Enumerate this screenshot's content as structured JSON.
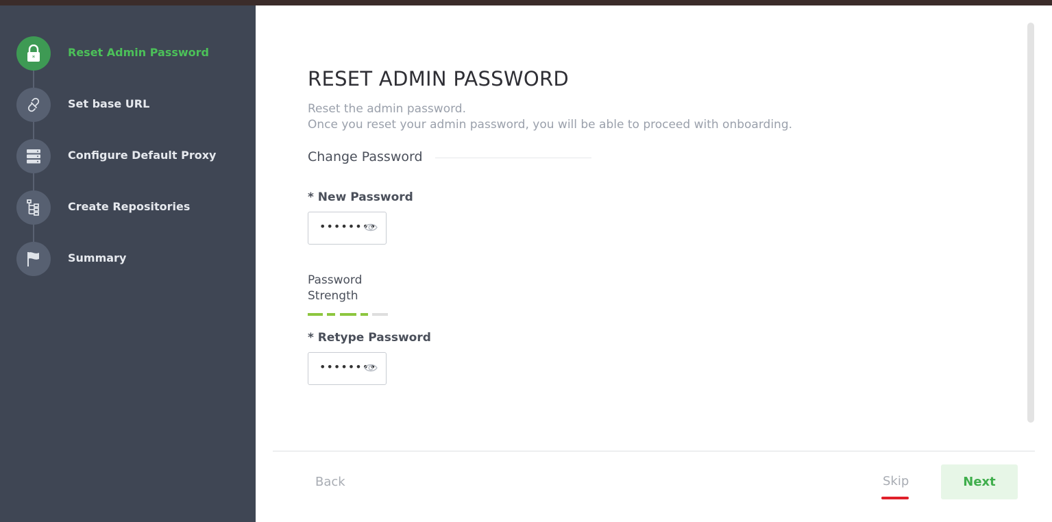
{
  "sidebar": {
    "steps": [
      {
        "label": "Reset Admin Password",
        "icon": "lock-icon",
        "active": true
      },
      {
        "label": "Set base URL",
        "icon": "link-icon",
        "active": false
      },
      {
        "label": "Configure Default Proxy",
        "icon": "server-icon",
        "active": false
      },
      {
        "label": "Create Repositories",
        "icon": "tree-icon",
        "active": false
      },
      {
        "label": "Summary",
        "icon": "flag-icon",
        "active": false
      }
    ]
  },
  "main": {
    "title": "RESET ADMIN PASSWORD",
    "description_line1": "Reset the admin password.",
    "description_line2": "Once you reset your admin password, you will be able to proceed with onboarding.",
    "section_title": "Change Password",
    "new_password": {
      "label": "* New Password",
      "masked_value": "••••••••"
    },
    "strength": {
      "label_line1": "Password",
      "label_line2": "Strength",
      "level": 4,
      "max": 5
    },
    "retype_password": {
      "label": "* Retype Password",
      "masked_value": "••••••••"
    }
  },
  "footer": {
    "back_label": "Back",
    "skip_label": "Skip",
    "next_label": "Next"
  },
  "colors": {
    "accent_green": "#4cc159",
    "sidebar_bg": "#3f4654",
    "strength_green": "#8dc63f",
    "skip_underline": "#e0202a"
  }
}
